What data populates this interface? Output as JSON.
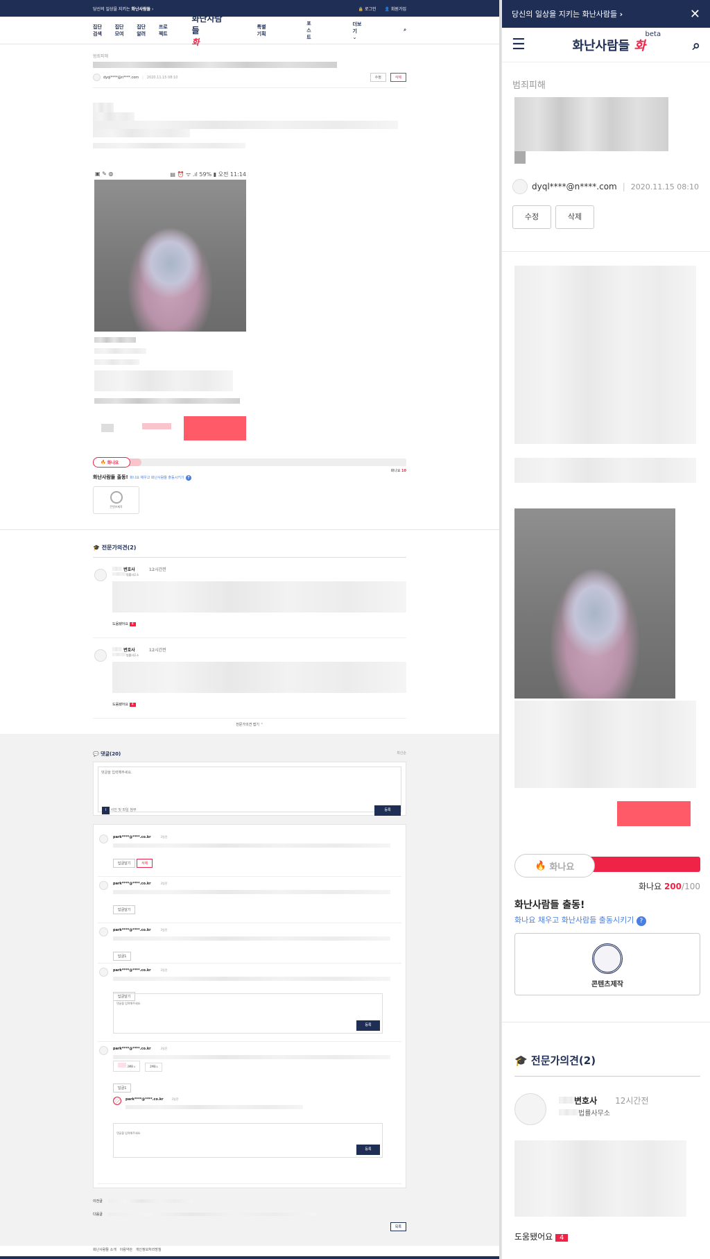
{
  "topbar": {
    "tagline": "당신의 일상을 지키는",
    "brand": "화난사람들",
    "login": "로그인",
    "signup": "회원가입"
  },
  "nav": {
    "items": [
      "집단검색",
      "집단모여",
      "집단알려",
      "프로젝트"
    ],
    "logo": "화난사람들",
    "logo_accent": "화",
    "beta": "beta",
    "items_right": [
      "특별기획",
      "포스트"
    ],
    "more": "더보기"
  },
  "post": {
    "category": "범죄피해",
    "author": "dyql****@n****.com",
    "date": "2020.11.15 08:10",
    "edit": "수정",
    "delete": "삭제",
    "phone_time": "오전 11:14",
    "phone_battery": "59%"
  },
  "hwanayo": {
    "label": "화나요",
    "count": "200",
    "max": "/100",
    "desk_count": "10",
    "desk_label": "화나요",
    "title": "화난사람들 출동!",
    "subtitle": "화나요 채우고 화난사람들 출동시키기",
    "badge_label": "콘텐츠제작",
    "fill": 0.85
  },
  "experts": {
    "title": "전문가의견(2)",
    "items": [
      {
        "role": "변호사",
        "org": "법률사무소",
        "time": "12시간전",
        "helpful": "도움됐어요",
        "count": "4"
      },
      {
        "role": "변호사",
        "org": "법률사무소",
        "time": "12시간전",
        "helpful": "도움됐어요",
        "count": "4"
      }
    ],
    "fold": "전문가의견 접기"
  },
  "comments": {
    "title": "댓글(20)",
    "sort": "최신순",
    "placeholder": "댓글을 입력해주세요.",
    "attach": "사진 및 파일 첨부",
    "submit": "등록",
    "items": [
      {
        "user": "park****@****.co.kr",
        "time": "3일전",
        "reply": "답글달기",
        "delete": "삭제"
      },
      {
        "user": "park****@****.co.kr",
        "time": "3일전",
        "reply": "답글달기"
      },
      {
        "user": "park****@****.co.kr",
        "time": "3일전",
        "reply": "답글1"
      },
      {
        "user": "park****@****.co.kr",
        "time": "3일전",
        "reply": "답글달기"
      },
      {
        "user": "park****@****.co.kr",
        "time": "3일전",
        "reply": "답글1"
      }
    ],
    "reply_user": "park****@****.co.kr",
    "reply_time": "3일전",
    "file1": "3MB",
    "file2": "2MB",
    "prev": "이전글",
    "next": "다음글",
    "list": "목록"
  },
  "footer": {
    "links": [
      "화난사람들 소개",
      "이용약관",
      "개인정보처리방침"
    ]
  },
  "mobile": {
    "banner": "당신의 일상을 지키는 화난사람들",
    "close": "✕",
    "edit": "수정",
    "delete": "삭제",
    "helpful": "도움됐어요",
    "count": "4"
  }
}
